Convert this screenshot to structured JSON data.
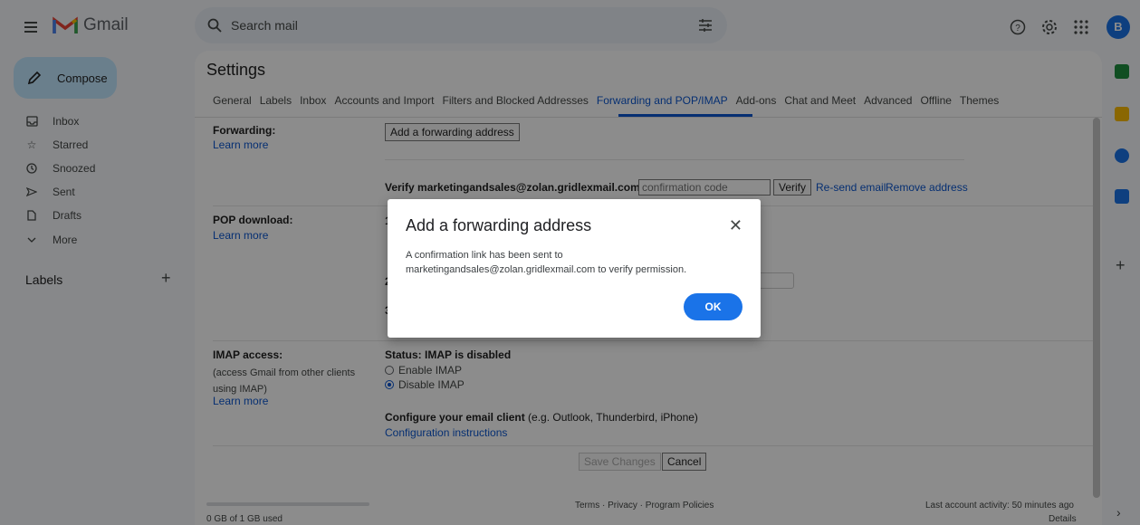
{
  "app": {
    "name": "Gmail"
  },
  "search": {
    "placeholder": "Search mail"
  },
  "header": {
    "avatar_letter": "B"
  },
  "nav": {
    "compose": "Compose",
    "items": [
      {
        "label": "Inbox",
        "icon": "inbox-icon"
      },
      {
        "label": "Starred",
        "icon": "star-icon"
      },
      {
        "label": "Snoozed",
        "icon": "clock-icon"
      },
      {
        "label": "Sent",
        "icon": "send-icon"
      },
      {
        "label": "Drafts",
        "icon": "draft-icon"
      },
      {
        "label": "More",
        "icon": "chevron-down-icon"
      }
    ],
    "labels_title": "Labels",
    "labels_add": "+"
  },
  "settings": {
    "title": "Settings",
    "tabs": [
      "General",
      "Labels",
      "Inbox",
      "Accounts and Import",
      "Filters and Blocked Addresses",
      "Forwarding and POP/IMAP",
      "Add-ons",
      "Chat and Meet",
      "Advanced",
      "Offline",
      "Themes"
    ],
    "active_tab": "Forwarding and POP/IMAP"
  },
  "forwarding": {
    "label": "Forwarding:",
    "learn_more": "Learn more",
    "add_button": "Add a forwarding address",
    "verify_text": "Verify marketingandsales@zolan.gridlexmail.com",
    "code_placeholder": "confirmation code",
    "verify_button": "Verify",
    "resend": "Re-send email",
    "remove": "Remove address"
  },
  "pop": {
    "label": "POP download:",
    "learn_more": "Learn more",
    "step1": "1",
    "step2": "2",
    "step3": "3"
  },
  "imap": {
    "label": "IMAP access:",
    "desc": "(access Gmail from other clients using IMAP)",
    "learn_more": "Learn more",
    "status": "Status: IMAP is disabled",
    "enable": "Enable IMAP",
    "disable": "Disable IMAP",
    "configure_bold": "Configure your email client",
    "configure_rest": " (e.g. Outlook, Thunderbird, iPhone)",
    "config_link": "Configuration instructions"
  },
  "actions": {
    "save": "Save Changes",
    "cancel": "Cancel"
  },
  "footer": {
    "storage": "0 GB of 1 GB used",
    "links": "Terms · Privacy · Program Policies",
    "activity": "Last account activity: 50 minutes ago",
    "details": "Details"
  },
  "dialog": {
    "title": "Add a forwarding address",
    "message": "A confirmation link has been sent to marketingandsales@zolan.gridlexmail.com to verify permission.",
    "ok": "OK",
    "close": "✕"
  },
  "colors": {
    "accent": "#0b57d0",
    "compose_bg": "#c2e7ff",
    "ok_button": "#1a73e8"
  }
}
